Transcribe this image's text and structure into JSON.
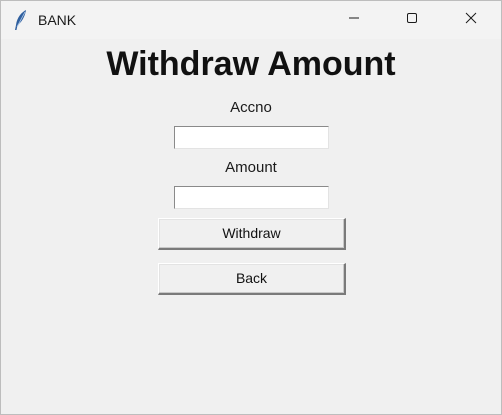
{
  "window": {
    "title": "BANK",
    "icon": "feather-icon",
    "controls": [
      "minimize-icon",
      "maximize-icon",
      "close-icon"
    ]
  },
  "form": {
    "heading": "Withdraw Amount",
    "accno_label": "Accno",
    "accno_value": "",
    "amount_label": "Amount",
    "amount_value": "",
    "withdraw_button": "Withdraw",
    "back_button": "Back"
  },
  "colors": {
    "background": "#f0f0f0",
    "entry_background": "#ffffff",
    "feather_icon": "#2f5f9e"
  }
}
